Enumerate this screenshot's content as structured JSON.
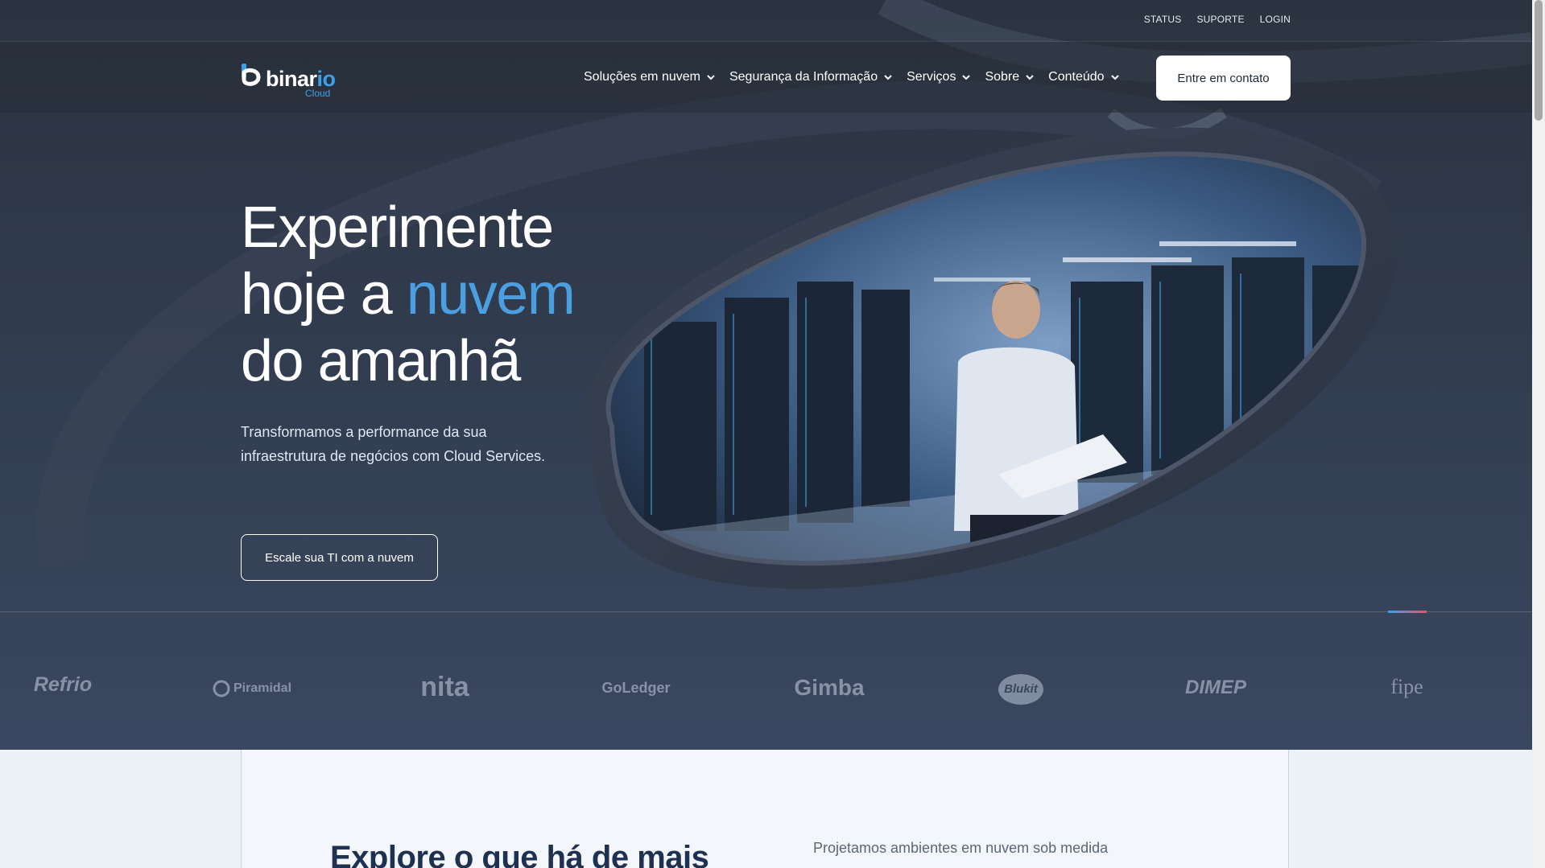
{
  "colors": {
    "accent": "#4b9fe0",
    "brand_blue": "#3da0e6",
    "hero_bg": "#303b4d"
  },
  "utility": {
    "links": [
      "STATUS",
      "SUPORTE",
      "LOGIN"
    ]
  },
  "brand": {
    "name": "binar",
    "name_suffix": "io",
    "sub": "Cloud"
  },
  "nav": {
    "items": [
      {
        "label": "Soluções em nuvem",
        "icon": "chevron-down-icon"
      },
      {
        "label": "Segurança da Informação",
        "icon": "chevron-down-icon"
      },
      {
        "label": "Serviços",
        "icon": "chevron-down-icon"
      },
      {
        "label": "Sobre",
        "icon": "chevron-down-icon"
      },
      {
        "label": "Conteúdo",
        "icon": "chevron-down-icon"
      }
    ],
    "contact_label": "Entre em contato"
  },
  "hero": {
    "title_line1": "Experimente",
    "title_line2_prefix": "hoje a ",
    "title_line2_accent": "nuvem",
    "title_line3": "do amanhã",
    "subtitle": "Transformamos a performance da sua infraestrutura de negócios com Cloud Services.",
    "cta_label": "Escale sua TI com a nuvem"
  },
  "clients": [
    "Refrio",
    "Piramidal",
    "nita",
    "GoLedger",
    "Gimba",
    "Blukit",
    "DIMEP",
    "fipe"
  ],
  "lower": {
    "title": "Explore o que há de mais",
    "text": "Projetamos ambientes em nuvem sob medida"
  }
}
